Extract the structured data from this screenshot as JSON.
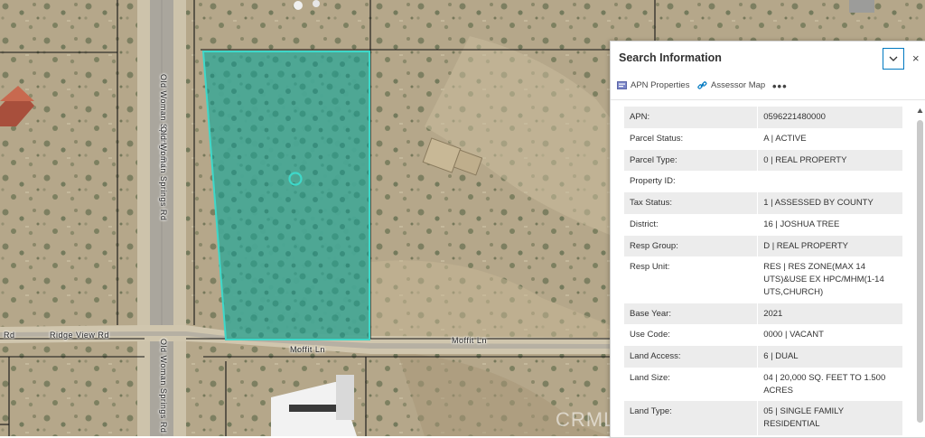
{
  "map": {
    "road_labels": {
      "old_woman_upper": "Old Woman Springs Rd",
      "old_woman_middle": "Old Woman Springs Rd",
      "old_woman_lower": "Old Woman Springs Rd",
      "ridge_view": "Ridge View Rd",
      "rd_left": "Rd",
      "moffit_1": "Moffit Ln",
      "moffit_2": "Moffit Ln"
    },
    "parcel_color": "#3ed8c9",
    "watermark": "CRMLS"
  },
  "panel": {
    "title": "Search Information",
    "close_glyph": "×",
    "actions": {
      "apn_properties": "APN Properties",
      "assessor_map": "Assessor Map",
      "more": "•••"
    },
    "rows": [
      {
        "key": "APN:",
        "value": "0596221480000"
      },
      {
        "key": "Parcel Status:",
        "value": "A | ACTIVE"
      },
      {
        "key": "Parcel Type:",
        "value": "0 | REAL PROPERTY"
      },
      {
        "key": "Property ID:",
        "value": ""
      },
      {
        "key": "Tax Status:",
        "value": "1 | ASSESSED BY COUNTY"
      },
      {
        "key": "District:",
        "value": "16 | JOSHUA TREE"
      },
      {
        "key": "Resp Group:",
        "value": "D | REAL PROPERTY"
      },
      {
        "key": "Resp Unit:",
        "value": "RES | RES ZONE(MAX 14 UTS)&USE EX HPC/MHM(1-14 UTS,CHURCH)"
      },
      {
        "key": "Base Year:",
        "value": "2021"
      },
      {
        "key": "Use Code:",
        "value": "0000 | VACANT"
      },
      {
        "key": "Land Access:",
        "value": "6 | DUAL"
      },
      {
        "key": "Land Size:",
        "value": "04 | 20,000 SQ. FEET TO 1.500 ACRES"
      },
      {
        "key": "Land Type:",
        "value": "05 | SINGLE FAMILY RESIDENTIAL"
      }
    ],
    "accent_color": "#0079c1"
  }
}
